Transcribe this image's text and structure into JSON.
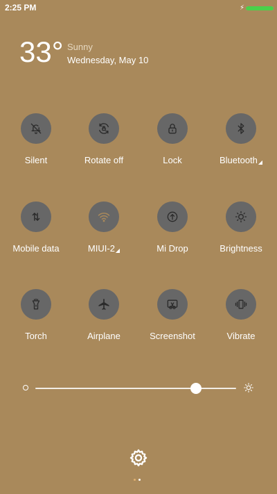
{
  "status_bar": {
    "time": "2:25 PM",
    "battery_level": 1.0,
    "battery_color": "#4ad04a"
  },
  "weather": {
    "temperature": "33°",
    "condition": "Sunny",
    "date": "Wednesday, May 10"
  },
  "tiles": [
    {
      "label": "Silent",
      "icon": "bell-off-icon",
      "has_arrow": false
    },
    {
      "label": "Rotate off",
      "icon": "rotate-lock-icon",
      "has_arrow": false
    },
    {
      "label": "Lock",
      "icon": "lock-icon",
      "has_arrow": false
    },
    {
      "label": "Bluetooth",
      "icon": "bluetooth-icon",
      "has_arrow": true
    },
    {
      "label": "Mobile data",
      "icon": "mobile-data-icon",
      "has_arrow": false
    },
    {
      "label": "MIUI-2",
      "icon": "wifi-icon",
      "has_arrow": true
    },
    {
      "label": "Mi Drop",
      "icon": "mi-drop-icon",
      "has_arrow": false
    },
    {
      "label": "Brightness",
      "icon": "brightness-icon",
      "has_arrow": false
    },
    {
      "label": "Torch",
      "icon": "torch-icon",
      "has_arrow": false
    },
    {
      "label": "Airplane",
      "icon": "airplane-icon",
      "has_arrow": false
    },
    {
      "label": "Screenshot",
      "icon": "screenshot-icon",
      "has_arrow": false
    },
    {
      "label": "Vibrate",
      "icon": "vibrate-icon",
      "has_arrow": false
    }
  ],
  "brightness": {
    "level": 0.8
  },
  "colors": {
    "background": "#a9895b",
    "tile_circle": "#676767"
  },
  "pager": {
    "current": 2,
    "total": 2
  }
}
